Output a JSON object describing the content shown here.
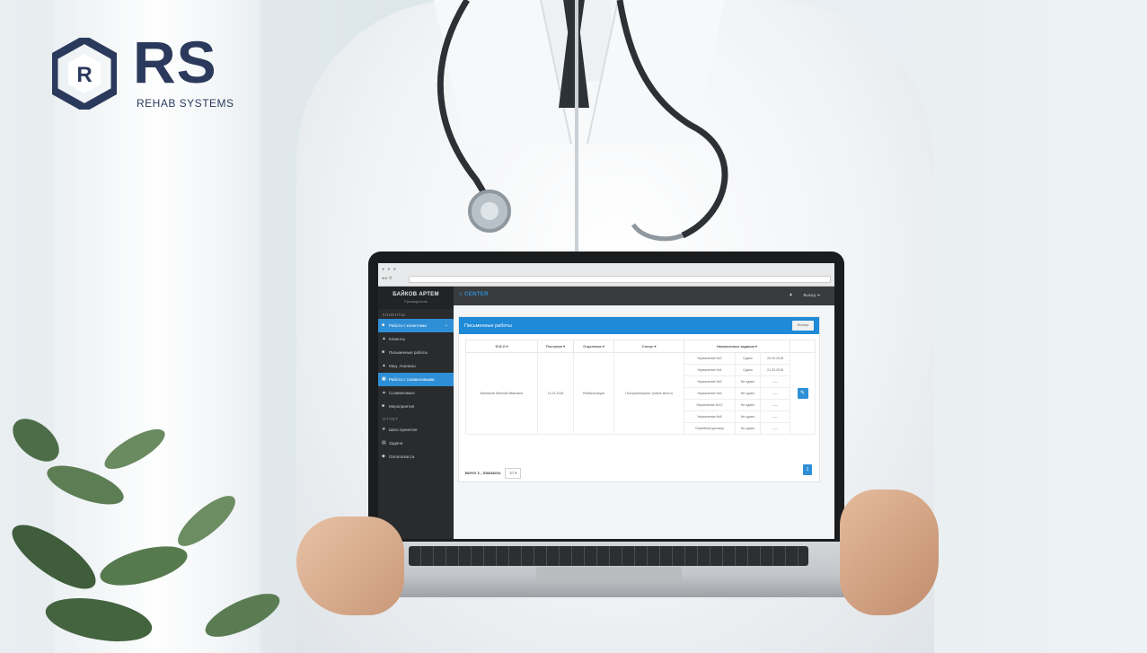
{
  "logo": {
    "letter": "R",
    "wordmark": "RS",
    "tagline": "REHAB SYSTEMS"
  },
  "colors": {
    "brand_navy": "#2b3a5c",
    "accent_blue": "#2f8fd6",
    "sidebar_dark": "#2a2b2d"
  },
  "app": {
    "user_name": "БАЙКОВ АРТЕМ",
    "user_role": "Руководитель",
    "brand": "CENTER",
    "top_user": "Выход",
    "sidebar": {
      "section_clients": "КЛИЕНТЫ",
      "section_report": "ОТЧЕТ",
      "items": [
        {
          "label": "Работа с клиентами",
          "icon": "users-icon",
          "active": true
        },
        {
          "label": "Клиенты",
          "icon": "user-icon",
          "active": false
        },
        {
          "label": "Письменные работы",
          "icon": "file-icon",
          "active": false
        },
        {
          "label": "Мед. Анализы",
          "icon": "user-icon",
          "active": false
        },
        {
          "label": "Работа с созависимыми",
          "icon": "folder-icon",
          "active": true
        },
        {
          "label": "Созависимые",
          "icon": "user-icon",
          "active": false
        },
        {
          "label": "Мероприятия",
          "icon": "calendar-icon",
          "active": false
        }
      ],
      "report_items": [
        {
          "label": "Шаги принятия",
          "icon": "star-icon"
        },
        {
          "label": "Задачи",
          "icon": "list-icon"
        },
        {
          "label": "Оплата/касса",
          "icon": "money-icon"
        }
      ]
    },
    "card_title": "Письменные работы",
    "card_button": "Фильтр",
    "table": {
      "headers": [
        "Ф.И.О",
        "Поступил",
        "Отделение",
        "Статус",
        "Назначенные задания"
      ],
      "row": {
        "name": "Ванников Евгений Иванович",
        "admitted": "11.01.2018",
        "department": "Реабилитация",
        "status": "Поступил/принят (новое место)",
        "tasks": [
          {
            "task": "Упражнение №3",
            "state": "Сдано",
            "date": "20.03.2018"
          },
          {
            "task": "Упражнение №4",
            "state": "Сдано",
            "date": "21.03.2018"
          },
          {
            "task": "Упражнение №5",
            "state": "Не сдано",
            "date": "-----"
          },
          {
            "task": "Упражнение №6",
            "state": "Не сдано",
            "date": "-----"
          },
          {
            "task": "Упражнение №12",
            "state": "Не сдано",
            "date": "-----"
          },
          {
            "task": "Упражнение №8",
            "state": "Не сдано",
            "date": "-----"
          },
          {
            "task": "Семейный договор",
            "state": "Не сдано",
            "date": "-----"
          }
        ]
      }
    },
    "footer": {
      "total_text": "всего 1 , показать",
      "per_page": "10",
      "page": "1"
    }
  }
}
